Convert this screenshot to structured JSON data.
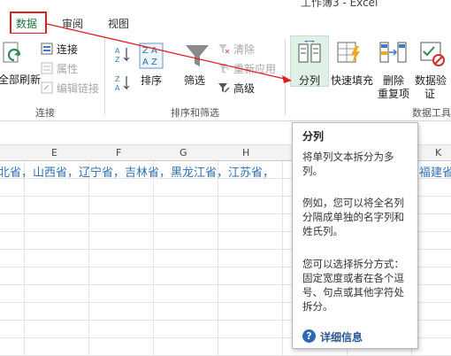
{
  "window": {
    "title": "工作簿3 - Excel"
  },
  "tabs": [
    {
      "label": "数据",
      "active": true
    },
    {
      "label": "审阅",
      "active": false
    },
    {
      "label": "视图",
      "active": false
    }
  ],
  "ribbon": {
    "connections": {
      "refresh_all": "全部刷新",
      "connections": "连接",
      "properties": "属性",
      "edit_links": "编辑链接",
      "group_label": "连接"
    },
    "sort_filter": {
      "sort": "排序",
      "filter": "筛选",
      "clear": "清除",
      "reapply": "重新应用",
      "advanced": "高级",
      "group_label": "排序和筛选"
    },
    "data_tools": {
      "text_to_columns": "分列",
      "flash_fill": "快速填充",
      "remove_duplicates_line1": "删除",
      "remove_duplicates_line2": "重复项",
      "data_validation_line1": "数据验",
      "data_validation_line2": "证",
      "group_label": "数据工具"
    }
  },
  "columns": [
    "E",
    "F",
    "G",
    "H",
    "K"
  ],
  "row1_text": "北省，山西省，辽宁省，吉林省，黑龙江省，江苏省，",
  "row1_tail": "福建省",
  "tooltip": {
    "title": "分列",
    "p1": "将单列文本拆分为多列。",
    "p2": "例如，您可以将全名列分隔成单独的名字列和姓氏列。",
    "p3": "您可以选择拆分方式：固定宽度或者在各个逗号、句点或其他字符处拆分。",
    "help": "详细信息"
  },
  "colors": {
    "accent": "#217346",
    "highlight": "#e02020",
    "text_blue": "#2f72b8"
  }
}
